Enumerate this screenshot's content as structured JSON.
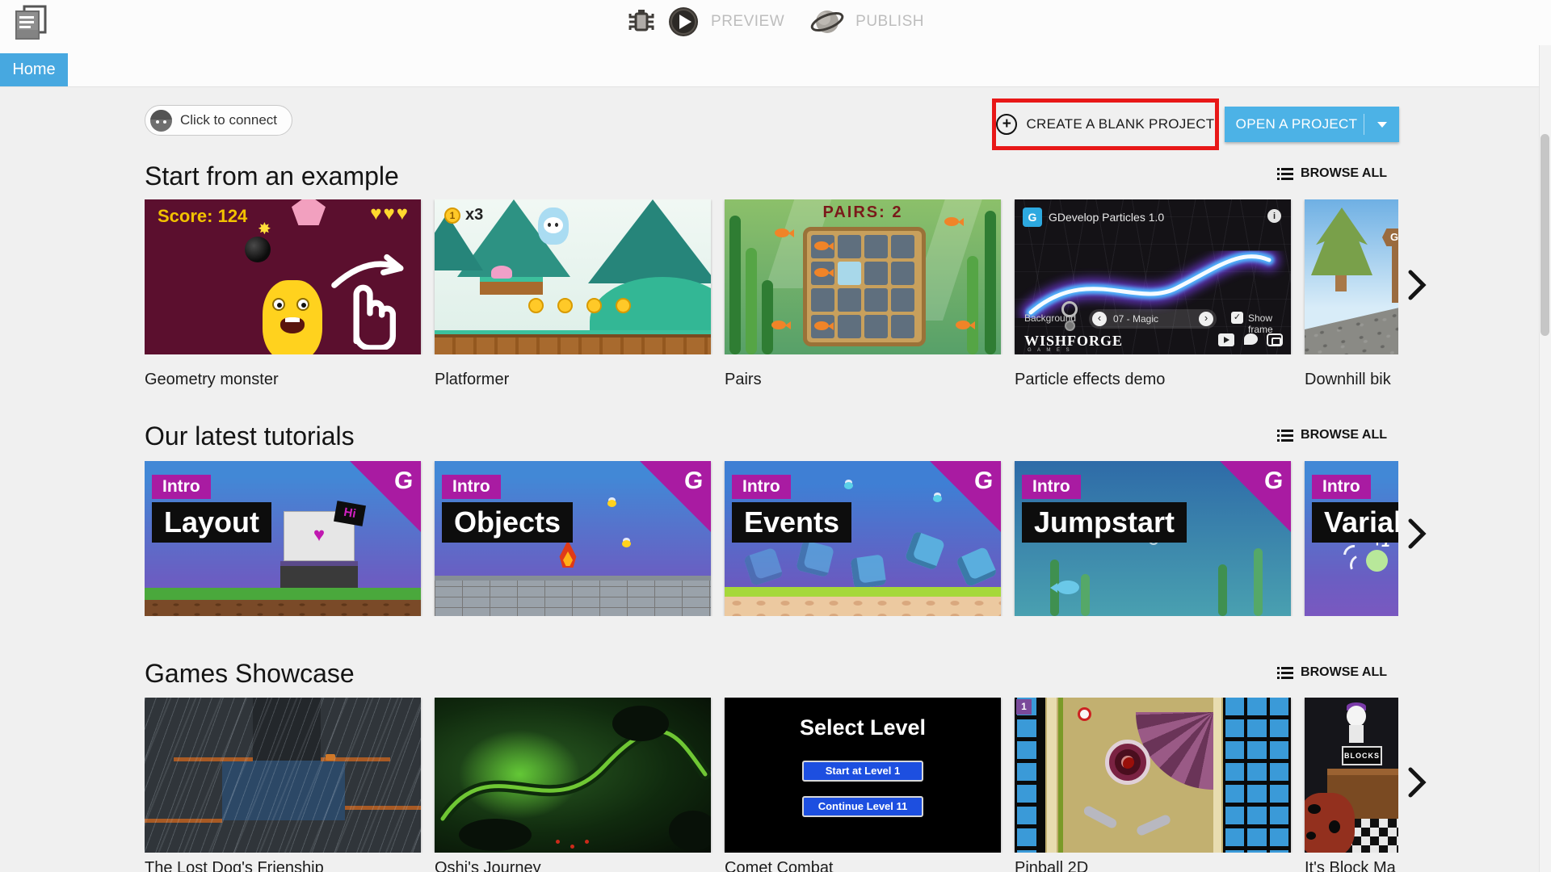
{
  "toolbar": {
    "preview_label": "PREVIEW",
    "publish_label": "PUBLISH"
  },
  "tabs": {
    "home_label": "Home"
  },
  "actions": {
    "connect_label": "Click to connect",
    "create_blank_label": "CREATE A BLANK PROJECT",
    "open_project_label": "OPEN A PROJECT"
  },
  "sections": {
    "examples": {
      "title": "Start from an example",
      "browse_all": "BROWSE ALL"
    },
    "tutorials": {
      "title": "Our latest tutorials",
      "browse_all": "BROWSE ALL"
    },
    "showcase": {
      "title": "Games Showcase",
      "browse_all": "BROWSE ALL"
    }
  },
  "examples": {
    "cards": [
      {
        "name": "Geometry monster",
        "score_text": "Score: 124",
        "lives_icon": "♥♥♥"
      },
      {
        "name": "Platformer",
        "coin_value": "1",
        "counter_text": "x3"
      },
      {
        "name": "Pairs",
        "header_text": "PAIRS: 2"
      },
      {
        "name": "Particle effects demo",
        "app_title": "GDevelop Particles 1.0",
        "logo_letter": "G",
        "info_glyph": "i",
        "background_label": "Background",
        "preset_label": "07 - Magic",
        "prev_glyph": "‹",
        "next_glyph": "›",
        "check_glyph": "✓",
        "show_frame_label": "Show frame",
        "brand": "WISHFORGE",
        "brand_sub": "G A M E S"
      },
      {
        "name": "Downhill bik",
        "sign_letter": "G"
      }
    ]
  },
  "tutorials": {
    "intro_label": "Intro",
    "logo_letter": "G",
    "cards": [
      {
        "title": "Layout",
        "hi_text": "Hi"
      },
      {
        "title": "Objects"
      },
      {
        "title": "Events"
      },
      {
        "title": "Jumpstart"
      },
      {
        "title": "Variab",
        "plus_one": "+1"
      }
    ]
  },
  "showcase": {
    "cards": [
      {
        "name": "The Lost Dog's Frienship"
      },
      {
        "name": "Oshi's Journey"
      },
      {
        "name": "Comet Combat",
        "title": "Select Level",
        "button1": "Start at Level 1",
        "button2": "Continue Level 11"
      },
      {
        "name": "Pinball 2D",
        "marker": "1"
      },
      {
        "name": "It's Block Ma",
        "sign_text": "BLOCKS"
      }
    ]
  },
  "colors": {
    "accent_blue": "#4cb2e6",
    "tab_blue": "#47a8e0",
    "highlight_red": "#e81818",
    "tutorial_magenta": "#a91ba2"
  }
}
